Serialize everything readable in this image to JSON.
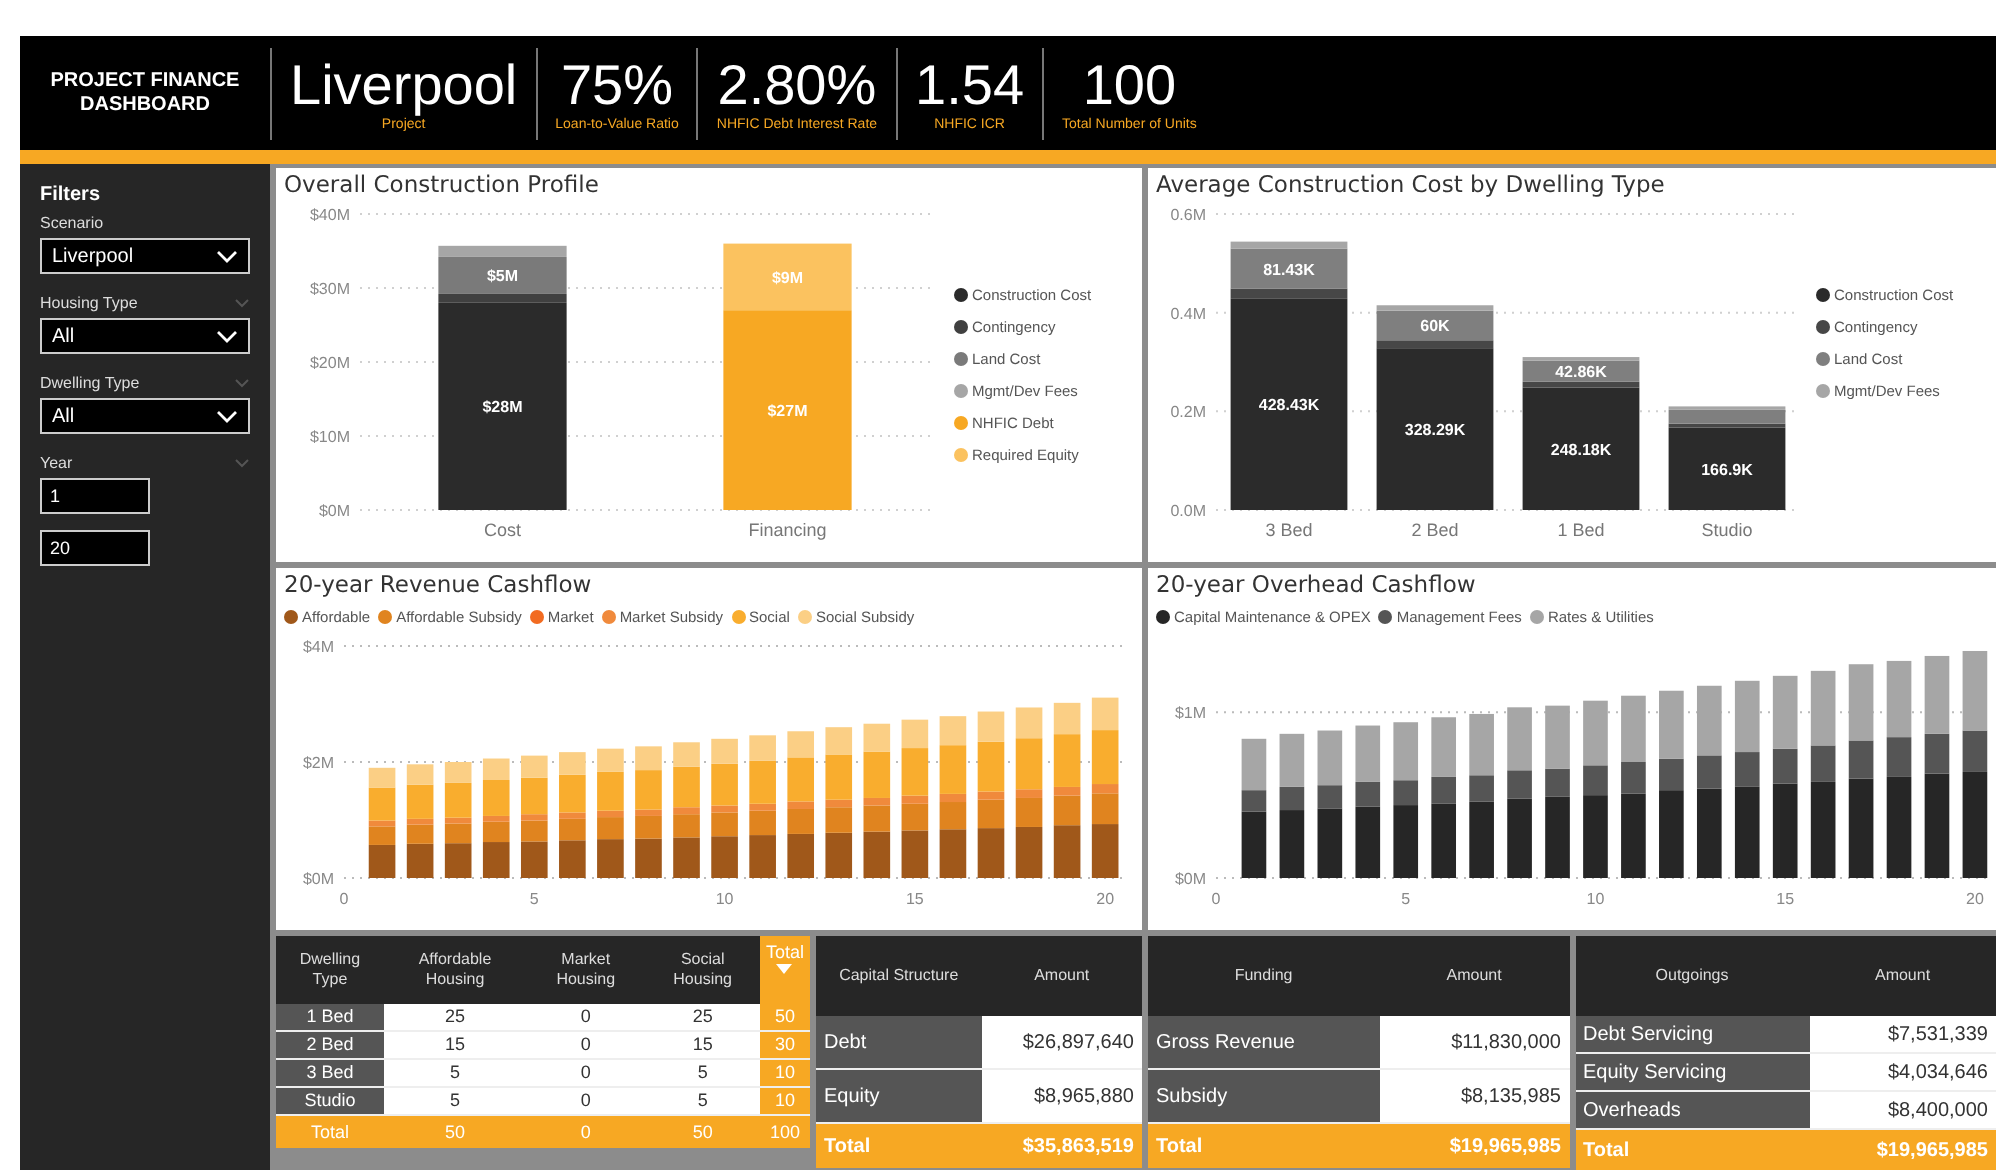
{
  "header": {
    "title": "PROJECT FINANCE DASHBOARD",
    "kpis": [
      {
        "value": "Liverpool",
        "label": "Project"
      },
      {
        "value": "75%",
        "label": "Loan-to-Value Ratio"
      },
      {
        "value": "2.80%",
        "label": "NHFIC Debt Interest Rate"
      },
      {
        "value": "1.54",
        "label": "NHFIC ICR"
      },
      {
        "value": "100",
        "label": "Total Number of Units"
      }
    ]
  },
  "sidebar": {
    "title": "Filters",
    "filters": [
      {
        "label": "Scenario",
        "kind": "dropdown",
        "value": "Liverpool",
        "collapsible": false
      },
      {
        "label": "Housing Type",
        "kind": "dropdown",
        "value": "All",
        "collapsible": true
      },
      {
        "label": "Dwelling Type",
        "kind": "dropdown",
        "value": "All",
        "collapsible": true
      },
      {
        "label": "Year",
        "kind": "range",
        "from": "1",
        "to": "20",
        "collapsible": true
      }
    ]
  },
  "construction_charts": [
    {
      "title": "Overall Construction Profile",
      "chart_data": {
        "type": "bar",
        "stacked": true,
        "categories": [
          "Cost",
          "Financing"
        ],
        "grid": true,
        "ylim": [
          0,
          40
        ],
        "yticks": [
          {
            "value": 0,
            "label": "$0M"
          },
          {
            "value": 10,
            "label": "$10M"
          },
          {
            "value": 20,
            "label": "$20M"
          },
          {
            "value": 30,
            "label": "$30M"
          },
          {
            "value": 40,
            "label": "$40M"
          }
        ],
        "series": [
          {
            "name": "Construction Cost",
            "color": "#2b2b2b",
            "values": [
              28,
              null
            ]
          },
          {
            "name": "Contingency",
            "color": "#404040",
            "values": [
              1.2,
              null
            ]
          },
          {
            "name": "Land Cost",
            "color": "#7a7a7a",
            "values": [
              5,
              null
            ]
          },
          {
            "name": "Mgmt/Dev Fees",
            "color": "#a6a6a6",
            "values": [
              1.5,
              null
            ]
          },
          {
            "name": "NHFIC Debt",
            "color": "#f7a823",
            "values": [
              null,
              27
            ]
          },
          {
            "name": "Required Equity",
            "color": "#fbc25f",
            "values": [
              null,
              9
            ]
          }
        ],
        "value_labels": [
          [
            "$28M",
            null
          ],
          [
            null,
            null
          ],
          [
            "$5M",
            null
          ],
          [
            null,
            null
          ],
          [
            null,
            "$27M"
          ],
          [
            null,
            "$9M"
          ]
        ]
      }
    },
    {
      "title": "Average Construction Cost by Dwelling Type",
      "chart_data": {
        "type": "bar",
        "stacked": true,
        "categories": [
          "3 Bed",
          "2 Bed",
          "1 Bed",
          "Studio"
        ],
        "grid": true,
        "ylim": [
          0,
          0.6
        ],
        "yticks": [
          {
            "value": 0,
            "label": "0.0M"
          },
          {
            "value": 0.2,
            "label": "0.2M"
          },
          {
            "value": 0.4,
            "label": "0.4M"
          },
          {
            "value": 0.6,
            "label": "0.6M"
          }
        ],
        "series": [
          {
            "name": "Construction Cost",
            "color": "#2b2b2b",
            "values": [
              0.428,
              0.328,
              0.248,
              0.167
            ]
          },
          {
            "name": "Contingency",
            "color": "#474747",
            "values": [
              0.021,
              0.016,
              0.012,
              0.008
            ]
          },
          {
            "name": "Land Cost",
            "color": "#7f7f7f",
            "values": [
              0.081,
              0.06,
              0.043,
              0.028
            ]
          },
          {
            "name": "Mgmt/Dev Fees",
            "color": "#a6a6a6",
            "values": [
              0.014,
              0.011,
              0.007,
              0.007
            ]
          }
        ],
        "value_labels": [
          [
            "428.43K",
            "328.29K",
            "248.18K",
            "166.9K"
          ],
          [
            null,
            null,
            null,
            null
          ],
          [
            "81.43K",
            "60K",
            "42.86K",
            null
          ],
          [
            null,
            null,
            null,
            null
          ]
        ]
      }
    }
  ],
  "cashflow_charts": [
    {
      "title": "20-year Revenue Cashflow",
      "chart_data": {
        "type": "bar",
        "stacked": true,
        "x": [
          1,
          2,
          3,
          4,
          5,
          6,
          7,
          8,
          9,
          10,
          11,
          12,
          13,
          14,
          15,
          16,
          17,
          18,
          19,
          20
        ],
        "xlim": [
          0,
          20.6
        ],
        "xticks": [
          0,
          5,
          10,
          15,
          20
        ],
        "grid": true,
        "ylim": [
          0,
          4
        ],
        "yticks": [
          {
            "value": 0,
            "label": "$0M"
          },
          {
            "value": 2,
            "label": "$2M"
          },
          {
            "value": 4,
            "label": "$4M"
          }
        ],
        "series": [
          {
            "name": "Affordable",
            "color": "#a0581a",
            "values": [
              0.57,
              0.59,
              0.6,
              0.62,
              0.63,
              0.65,
              0.67,
              0.68,
              0.7,
              0.72,
              0.74,
              0.76,
              0.78,
              0.8,
              0.82,
              0.84,
              0.86,
              0.88,
              0.91,
              0.93
            ]
          },
          {
            "name": "Affordable Subsidy",
            "color": "#e0841f",
            "values": [
              0.32,
              0.33,
              0.34,
              0.35,
              0.36,
              0.37,
              0.38,
              0.39,
              0.4,
              0.41,
              0.42,
              0.43,
              0.44,
              0.45,
              0.46,
              0.47,
              0.49,
              0.5,
              0.51,
              0.53
            ]
          },
          {
            "name": "Market",
            "color": "#f26b21",
            "values": [
              0,
              0,
              0,
              0,
              0,
              0,
              0,
              0,
              0,
              0,
              0,
              0,
              0,
              0,
              0,
              0,
              0,
              0,
              0,
              0
            ]
          },
          {
            "name": "Market Subsidy",
            "color": "#f08a3c",
            "values": [
              0.1,
              0.1,
              0.1,
              0.1,
              0.11,
              0.11,
              0.11,
              0.11,
              0.12,
              0.12,
              0.12,
              0.13,
              0.13,
              0.13,
              0.14,
              0.14,
              0.14,
              0.15,
              0.15,
              0.16
            ]
          },
          {
            "name": "Social",
            "color": "#f9ad2e",
            "values": [
              0.57,
              0.59,
              0.6,
              0.62,
              0.63,
              0.65,
              0.67,
              0.68,
              0.7,
              0.72,
              0.74,
              0.76,
              0.78,
              0.8,
              0.82,
              0.84,
              0.86,
              0.88,
              0.91,
              0.93
            ]
          },
          {
            "name": "Social Subsidy",
            "color": "#fbcf85",
            "values": [
              0.34,
              0.35,
              0.36,
              0.37,
              0.38,
              0.39,
              0.4,
              0.41,
              0.42,
              0.43,
              0.44,
              0.45,
              0.47,
              0.48,
              0.49,
              0.5,
              0.52,
              0.53,
              0.54,
              0.56
            ]
          }
        ]
      }
    },
    {
      "title": "20-year Overhead Cashflow",
      "chart_data": {
        "type": "bar",
        "stacked": true,
        "x": [
          1,
          2,
          3,
          4,
          5,
          6,
          7,
          8,
          9,
          10,
          11,
          12,
          13,
          14,
          15,
          16,
          17,
          18,
          19,
          20
        ],
        "xlim": [
          0,
          20.45
        ],
        "xticks": [
          0,
          5,
          10,
          15,
          20
        ],
        "grid": true,
        "ylim": [
          0,
          1.4
        ],
        "yticks": [
          {
            "value": 0,
            "label": "$0M"
          },
          {
            "value": 1,
            "label": "$1M"
          }
        ],
        "series": [
          {
            "name": "Capital Maintenance & OPEX",
            "color": "#262626",
            "values": [
              0.4,
              0.41,
              0.42,
              0.43,
              0.44,
              0.45,
              0.46,
              0.48,
              0.49,
              0.5,
              0.51,
              0.53,
              0.54,
              0.55,
              0.57,
              0.58,
              0.6,
              0.61,
              0.63,
              0.64
            ]
          },
          {
            "name": "Management Fees",
            "color": "#555555",
            "values": [
              0.13,
              0.14,
              0.14,
              0.15,
              0.15,
              0.16,
              0.16,
              0.17,
              0.17,
              0.18,
              0.19,
              0.19,
              0.2,
              0.21,
              0.21,
              0.22,
              0.23,
              0.24,
              0.24,
              0.25
            ]
          },
          {
            "name": "Rates & Utilities",
            "color": "#a6a6a6",
            "values": [
              0.31,
              0.32,
              0.33,
              0.34,
              0.35,
              0.36,
              0.37,
              0.38,
              0.38,
              0.39,
              0.4,
              0.41,
              0.42,
              0.43,
              0.44,
              0.45,
              0.46,
              0.46,
              0.47,
              0.48
            ]
          }
        ]
      }
    }
  ],
  "tables_left": [
    {
      "columns": [
        {
          "label": "Dwelling Type",
          "kind": "label"
        },
        {
          "label": "Affordable Housing",
          "kind": "value"
        },
        {
          "label": "Market Housing",
          "kind": "value"
        },
        {
          "label": "Social Housing",
          "kind": "value"
        },
        {
          "label": "Total",
          "kind": "total",
          "sorted": true
        }
      ],
      "rows": [
        {
          "kind": "data",
          "cells": [
            "1 Bed",
            "25",
            "0",
            "25",
            "50"
          ]
        },
        {
          "kind": "data",
          "cells": [
            "2 Bed",
            "15",
            "0",
            "15",
            "30"
          ]
        },
        {
          "kind": "data",
          "cells": [
            "3 Bed",
            "5",
            "0",
            "5",
            "10"
          ]
        },
        {
          "kind": "data",
          "cells": [
            "Studio",
            "5",
            "0",
            "5",
            "10"
          ]
        },
        {
          "kind": "total",
          "cells": [
            "Total",
            "50",
            "0",
            "50",
            "100"
          ]
        }
      ]
    },
    {
      "columns": [
        {
          "label": "Capital Structure",
          "kind": "label"
        },
        {
          "label": "Amount",
          "kind": "amount"
        }
      ],
      "rows": [
        {
          "kind": "data",
          "cells": [
            "Debt",
            "$26,897,640"
          ]
        },
        {
          "kind": "data",
          "cells": [
            "Equity",
            "$8,965,880"
          ]
        },
        {
          "kind": "total",
          "cells": [
            "Total",
            "$35,863,519"
          ]
        }
      ]
    }
  ],
  "tables_right": [
    {
      "columns": [
        {
          "label": "Funding",
          "kind": "label"
        },
        {
          "label": "Amount",
          "kind": "amount"
        }
      ],
      "rows": [
        {
          "kind": "data",
          "cells": [
            "Gross Revenue",
            "$11,830,000"
          ]
        },
        {
          "kind": "data",
          "cells": [
            "Subsidy",
            "$8,135,985"
          ]
        },
        {
          "kind": "total",
          "cells": [
            "Total",
            "$19,965,985"
          ]
        }
      ]
    },
    {
      "columns": [
        {
          "label": "Outgoings",
          "kind": "label"
        },
        {
          "label": "Amount",
          "kind": "amount"
        }
      ],
      "rows": [
        {
          "kind": "data",
          "cells": [
            "Debt Servicing",
            "$7,531,339"
          ]
        },
        {
          "kind": "data",
          "cells": [
            "Equity Servicing",
            "$4,034,646"
          ]
        },
        {
          "kind": "data",
          "cells": [
            "Overheads",
            "$8,400,000"
          ]
        },
        {
          "kind": "total",
          "cells": [
            "Total",
            "$19,965,985"
          ]
        }
      ]
    }
  ]
}
